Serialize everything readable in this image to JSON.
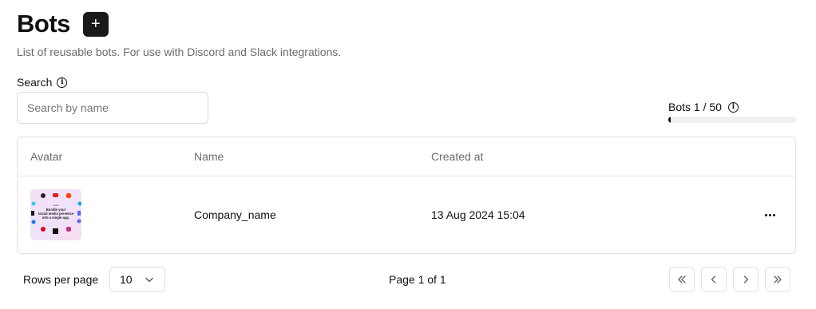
{
  "header": {
    "title": "Bots",
    "add_label": "+",
    "subtitle": "List of reusable bots. For use with Discord and Slack integrations."
  },
  "search": {
    "label": "Search",
    "placeholder": "Search by name",
    "value": ""
  },
  "quota": {
    "label": "Bots 1 / 50",
    "used": 1,
    "limit": 50
  },
  "table": {
    "columns": [
      "Avatar",
      "Name",
      "Created at"
    ],
    "rows": [
      {
        "avatar_text": [
          "Bundle your",
          "social media presence",
          "into a single app."
        ],
        "name": "Company_name",
        "created_at": "13 Aug 2024 15:04"
      }
    ]
  },
  "pagination": {
    "rows_label": "Rows per page",
    "rows_value": "10",
    "page_info": "Page 1 of 1"
  },
  "icons": {
    "info": "info-icon",
    "more": "more-horizontal-icon",
    "first": "chevrons-left-icon",
    "prev": "chevron-left-icon",
    "next": "chevron-right-icon",
    "last": "chevrons-right-icon"
  },
  "colors": {
    "primary": "#1a1a1a",
    "muted_text": "#6b6b6b",
    "border": "#e3e3e3",
    "avatar_bg": "#f3e0f7"
  }
}
